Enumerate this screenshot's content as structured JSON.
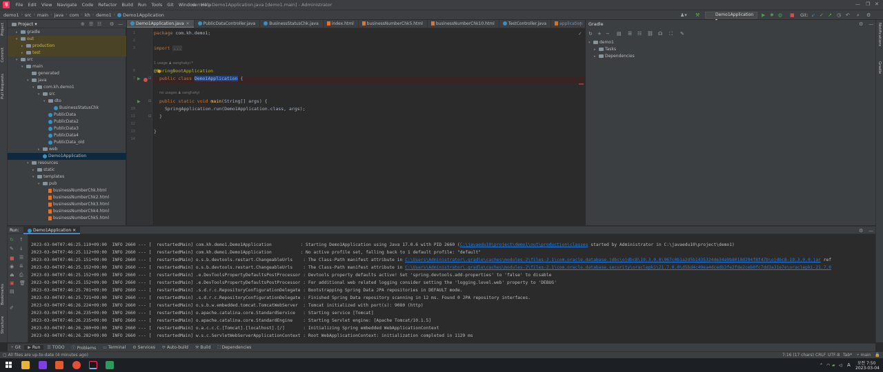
{
  "menubar": {
    "items": [
      "File",
      "Edit",
      "View",
      "Navigate",
      "Code",
      "Refactor",
      "Build",
      "Run",
      "Tools",
      "Git",
      "Window",
      "Help"
    ],
    "title": "demo1 - Demo1Application.java [demo1.main] - Administrator"
  },
  "breadcrumb": [
    "demo1",
    "src",
    "main",
    "java",
    "com",
    "kh",
    "demo1",
    "Demo1Application"
  ],
  "toolbar": {
    "run_config": "Demo1Application",
    "git_label": "Git:"
  },
  "project": {
    "title": "Project",
    "tree": [
      {
        "label": "gradle",
        "depth": 1,
        "type": "folder",
        "arrow": "▸"
      },
      {
        "label": "out",
        "depth": 1,
        "type": "folder",
        "arrow": "▾",
        "hl": true
      },
      {
        "label": "production",
        "depth": 2,
        "type": "folder",
        "arrow": "▸",
        "hl": true
      },
      {
        "label": "test",
        "depth": 2,
        "type": "folder",
        "arrow": "▸",
        "hl": true
      },
      {
        "label": "src",
        "depth": 1,
        "type": "folder",
        "arrow": "▾"
      },
      {
        "label": "main",
        "depth": 2,
        "type": "folder",
        "arrow": "▾"
      },
      {
        "label": "generated",
        "depth": 3,
        "type": "folder",
        "arrow": ""
      },
      {
        "label": "java",
        "depth": 3,
        "type": "folder",
        "arrow": "▾"
      },
      {
        "label": "com.kh.demo1",
        "depth": 4,
        "type": "folder",
        "arrow": "▾"
      },
      {
        "label": "src",
        "depth": 5,
        "type": "folder",
        "arrow": "▾"
      },
      {
        "label": "dto",
        "depth": 6,
        "type": "folder",
        "arrow": "▾"
      },
      {
        "label": "BusinessStatusChk",
        "depth": 7,
        "type": "class",
        "arrow": ""
      },
      {
        "label": "PublicData",
        "depth": 6,
        "type": "class",
        "arrow": ""
      },
      {
        "label": "PublicData2",
        "depth": 6,
        "type": "class",
        "arrow": ""
      },
      {
        "label": "PublicData3",
        "depth": 6,
        "type": "class",
        "arrow": ""
      },
      {
        "label": "PublicData4",
        "depth": 6,
        "type": "class",
        "arrow": ""
      },
      {
        "label": "PublicData_old",
        "depth": 6,
        "type": "class",
        "arrow": ""
      },
      {
        "label": "web",
        "depth": 5,
        "type": "folder",
        "arrow": "▸"
      },
      {
        "label": "Demo1Application",
        "depth": 5,
        "type": "class",
        "arrow": "",
        "sel": true
      },
      {
        "label": "resources",
        "depth": 3,
        "type": "folder",
        "arrow": "▾"
      },
      {
        "label": "static",
        "depth": 4,
        "type": "folder",
        "arrow": "▸"
      },
      {
        "label": "templates",
        "depth": 4,
        "type": "folder",
        "arrow": "▾"
      },
      {
        "label": "pub",
        "depth": 5,
        "type": "folder",
        "arrow": "▾"
      },
      {
        "label": "businessNumberChk.html",
        "depth": 6,
        "type": "html",
        "arrow": ""
      },
      {
        "label": "businessNumberChk2.html",
        "depth": 6,
        "type": "html",
        "arrow": ""
      },
      {
        "label": "businessNumberChk3.html",
        "depth": 6,
        "type": "html",
        "arrow": ""
      },
      {
        "label": "businessNumberChk4.html",
        "depth": 6,
        "type": "html",
        "arrow": ""
      },
      {
        "label": "businessNumberChk5.html",
        "depth": 6,
        "type": "html",
        "arrow": ""
      }
    ]
  },
  "tabs": [
    {
      "label": "Demo1Application.java",
      "type": "class",
      "active": true
    },
    {
      "label": "PublicDataController.java",
      "type": "class"
    },
    {
      "label": "BusinessStatusChk.java",
      "type": "class"
    },
    {
      "label": "index.html",
      "type": "html"
    },
    {
      "label": "businessNumberChk5.html",
      "type": "html"
    },
    {
      "label": "businessNumberChk10.html",
      "type": "html"
    },
    {
      "label": "TestController.java",
      "type": "class"
    },
    {
      "label": "application",
      "type": "file"
    }
  ],
  "editor": {
    "line_numbers": [
      "1",
      "2",
      "3",
      "",
      "6",
      "7",
      "",
      "10",
      "11",
      "12",
      "13",
      "14"
    ],
    "pkg_kw": "package",
    "pkg_name": " com.kh.demo1;",
    "import_kw": "import",
    "import_fold": "...",
    "hint1": "1 usage   ♟ sanghakyi *",
    "annotation": "@SpringBootApplication",
    "class_kw": "public class",
    "class_name": "Demo1Application",
    "class_brace": " {",
    "hint2": "no usages   ♟ sanghakyi",
    "main_kw": "public static void",
    "main_fn": "main",
    "main_args": "(String[] args) {",
    "run_line": "SpringApplication.run(Demo1Application.class, args);",
    "close_inner": "}",
    "close_outer": "}"
  },
  "gradle": {
    "title": "Gradle",
    "root": "demo1",
    "children": [
      "Tasks",
      "Dependencies"
    ]
  },
  "run": {
    "label": "Run:",
    "tab": "Demo1Application",
    "lines": [
      {
        "text": "2023-03-04T07:46:25.110+09:00  INFO 2660 --- [  restartedMain] com.kh.demo1.Demo1Application           : Starting Demo1Application using Java 17.0.6 with PID 2660 (",
        "link": "C:\\javaedu10\\project\\demo1\\out\\production\\classes",
        "tail": " started by Administrator in C:\\javaedu10\\project\\demo1)"
      },
      {
        "text": "2023-03-04T07:46:25.112+09:00  INFO 2660 --- [  restartedMain] com.kh.demo1.Demo1Application           : No active profile set, falling back to 1 default profile: \"default\"",
        "link": "",
        "tail": ""
      },
      {
        "text": "2023-03-04T07:46:25.151+09:00  INFO 2660 --- [  restartedMain] o.s.b.devtools.restart.ChangeableUrls    : The Class-Path manifest attribute in ",
        "link": "C:\\Users\\Administrator\\.gradle\\caches\\modules-2\\files-2.1\\com.oracle.database.jdbc\\ojdbc8\\19.3.0.0\\967c0b1a2d5b1435324de34a9b8018d294f8f47b\\ojdbc8-19.3.0.0.jar",
        "tail": " ref"
      },
      {
        "text": "2023-03-04T07:46:25.152+09:00  INFO 2660 --- [  restartedMain] o.s.b.devtools.restart.ChangeableUrls    : The Class-Path manifest attribute in ",
        "link": "C:\\Users\\Administrator\\.gradle\\caches\\modules-2\\files-2.1\\com.oracle.database.security\\oraclepki\\21.7.0.0\\d5bd4c49ea4dcedb3fe2fde2ceb0fc7dd3a31e7e\\oraclepki-21.7.0",
        "tail": ""
      },
      {
        "text": "2023-03-04T07:46:25.152+09:00  INFO 2660 --- [  restartedMain] .e.DevToolsPropertyDefaultsPostProcessor : Devtools property defaults active! Set 'spring.devtools.add-properties' to 'false' to disable",
        "link": "",
        "tail": ""
      },
      {
        "text": "2023-03-04T07:46:25.152+09:00  INFO 2660 --- [  restartedMain] .e.DevToolsPropertyDefaultsPostProcessor : For additional web related logging consider setting the 'logging.level.web' property to 'DEBUG'",
        "link": "",
        "tail": ""
      },
      {
        "text": "2023-03-04T07:46:25.701+09:00  INFO 2660 --- [  restartedMain] .s.d.r.c.RepositoryConfigurationDelegate : Bootstrapping Spring Data JPA repositories in DEFAULT mode.",
        "link": "",
        "tail": ""
      },
      {
        "text": "2023-03-04T07:46:25.721+09:00  INFO 2660 --- [  restartedMain] .s.d.r.c.RepositoryConfigurationDelegate : Finished Spring Data repository scanning in 12 ms. Found 0 JPA repository interfaces.",
        "link": "",
        "tail": ""
      },
      {
        "text": "2023-03-04T07:46:26.224+09:00  INFO 2660 --- [  restartedMain] o.s.b.w.embedded.tomcat.TomcatWebServer  : Tomcat initialized with port(s): 9080 (http)",
        "link": "",
        "tail": ""
      },
      {
        "text": "2023-03-04T07:46:26.235+09:00  INFO 2660 --- [  restartedMain] o.apache.catalina.core.StandardService   : Starting service [Tomcat]",
        "link": "",
        "tail": ""
      },
      {
        "text": "2023-03-04T07:46:26.235+09:00  INFO 2660 --- [  restartedMain] o.apache.catalina.core.StandardEngine    : Starting Servlet engine: [Apache Tomcat/10.1.5]",
        "link": "",
        "tail": ""
      },
      {
        "text": "2023-03-04T07:46:26.280+09:00  INFO 2660 --- [  restartedMain] o.a.c.c.C.[Tomcat].[localhost].[/]       : Initializing Spring embedded WebApplicationContext",
        "link": "",
        "tail": ""
      },
      {
        "text": "2023-03-04T07:46:26.282+09:00  INFO 2660 --- [  restartedMain] w.s.c.ServletWebServerApplicationContext : Root WebApplicationContext: initialization completed in 1129 ms",
        "link": "",
        "tail": ""
      }
    ]
  },
  "bottom_tabs": [
    "Git",
    "Run",
    "TODO",
    "Problems",
    "Terminal",
    "Services",
    "Auto-build",
    "Build",
    "Dependencies"
  ],
  "left_strip": [
    "Project",
    "Commit",
    "Pull Requests",
    "Bookmarks",
    "Structure"
  ],
  "right_strip": [
    "Notifications",
    "Gradle"
  ],
  "status": {
    "message": "All files are up-to-date (4 minutes ago)",
    "caret": "7:16 (17 chars)",
    "line_sep": "CRLF",
    "encoding": "UTF-8",
    "indent": "Tab*",
    "branch": "main"
  },
  "taskbar": {
    "time": "오전 7:50",
    "date": "2023-03-04",
    "ime": "A"
  },
  "colors": {
    "accent": "#4a88c7",
    "run_green": "#499c54",
    "stop_red": "#c75450",
    "link": "#287bde"
  }
}
